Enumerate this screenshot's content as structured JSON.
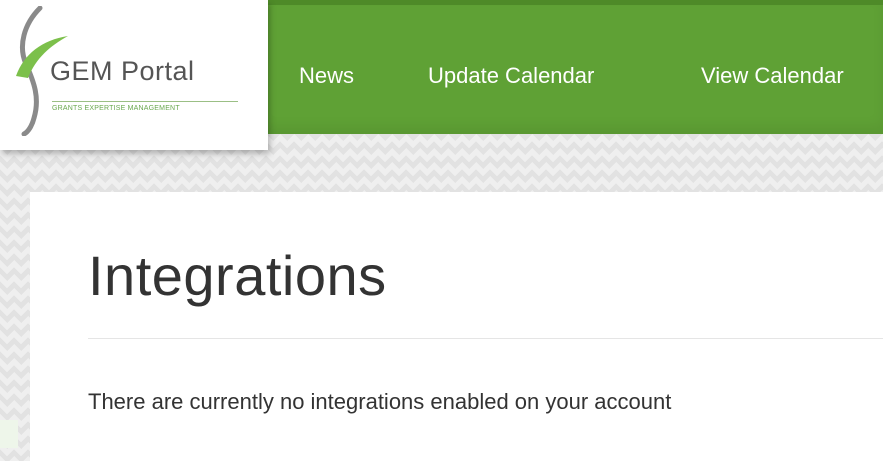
{
  "logo": {
    "title": "GEM Portal",
    "subtitle": "GRANTS EXPERTISE MANAGEMENT"
  },
  "nav": {
    "items": [
      {
        "label": "News"
      },
      {
        "label": "Update Calendar"
      },
      {
        "label": "View Calendar"
      }
    ]
  },
  "page": {
    "title": "Integrations",
    "message": "There are currently no integrations enabled on your account"
  },
  "colors": {
    "nav_green": "#5fa135",
    "nav_green_dark": "#4e8a28",
    "logo_green": "#6aa84f",
    "text_dark": "#333333"
  }
}
